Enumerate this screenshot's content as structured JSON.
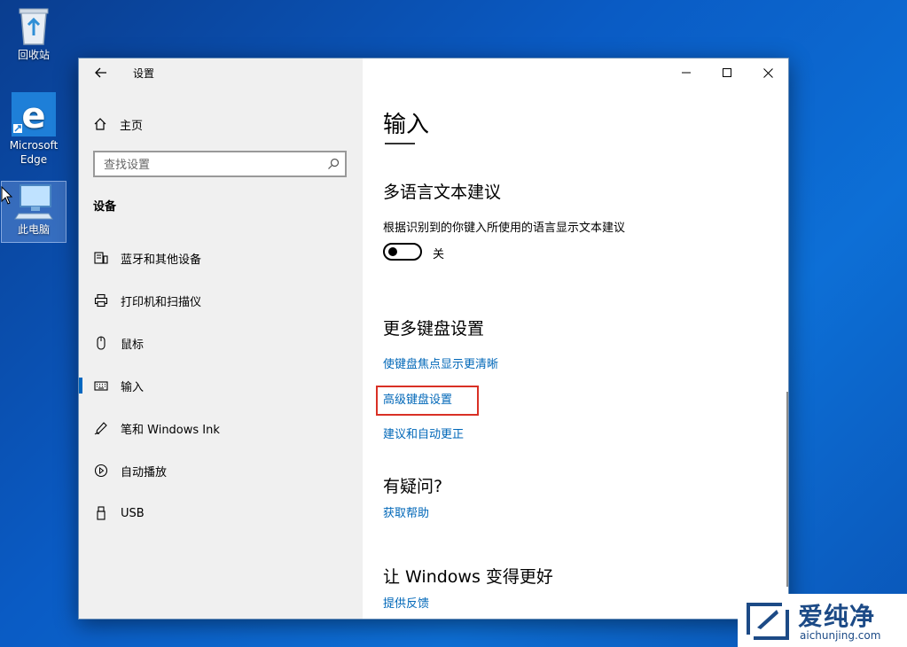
{
  "desktop": {
    "icons": [
      {
        "label": "回收站"
      },
      {
        "label": "Microsoft Edge"
      },
      {
        "label": "此电脑"
      }
    ]
  },
  "app": {
    "title": "设置"
  },
  "sidebar": {
    "home_label": "主页",
    "search_placeholder": "查找设置",
    "section_title": "设备",
    "items": [
      {
        "label": "蓝牙和其他设备",
        "icon": "bluetooth-device-icon"
      },
      {
        "label": "打印机和扫描仪",
        "icon": "printer-icon"
      },
      {
        "label": "鼠标",
        "icon": "mouse-icon"
      },
      {
        "label": "输入",
        "icon": "keyboard-icon",
        "active": true
      },
      {
        "label": "笔和 Windows Ink",
        "icon": "pen-icon"
      },
      {
        "label": "自动播放",
        "icon": "autoplay-icon"
      },
      {
        "label": "USB",
        "icon": "usb-icon"
      }
    ]
  },
  "main": {
    "title": "输入",
    "multilingual": {
      "heading": "多语言文本建议",
      "description": "根据识别到的你键入所使用的语言显示文本建议",
      "toggle_state": "关"
    },
    "more_keyboard": {
      "heading": "更多键盘设置",
      "links": [
        "使键盘焦点显示更清晰",
        "高级键盘设置",
        "建议和自动更正"
      ]
    },
    "questions": {
      "heading": "有疑问?",
      "link": "获取帮助"
    },
    "improve": {
      "heading": "让 Windows 变得更好",
      "link": "提供反馈"
    }
  },
  "watermark": {
    "brand": "爱纯净",
    "url": "aichunjing.com"
  },
  "colors": {
    "accent": "#0067c0",
    "link": "#0067b8",
    "highlight": "#d93025"
  }
}
